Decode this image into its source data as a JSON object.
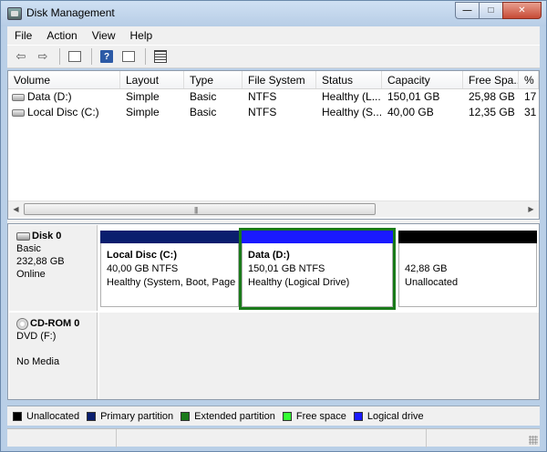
{
  "window": {
    "title": "Disk Management"
  },
  "caption": {
    "min": "—",
    "max": "□",
    "close": "✕"
  },
  "menu": [
    "File",
    "Action",
    "View",
    "Help"
  ],
  "toolbar": {
    "buttons": [
      {
        "name": "back-button",
        "glyph": "⇦"
      },
      {
        "name": "forward-button",
        "glyph": "⇨"
      },
      {
        "name": "properties-button",
        "glyph": ""
      },
      {
        "name": "help-button",
        "glyph": "?"
      },
      {
        "name": "show-hide-pane-button",
        "glyph": ""
      },
      {
        "name": "settings-button",
        "glyph": ""
      }
    ]
  },
  "volume_list": {
    "columns": [
      "Volume",
      "Layout",
      "Type",
      "File System",
      "Status",
      "Capacity",
      "Free Spa...",
      "% F"
    ],
    "rows": [
      [
        "Data (D:)",
        "Simple",
        "Basic",
        "NTFS",
        "Healthy (L...",
        "150,01 GB",
        "25,98 GB",
        "17"
      ],
      [
        "Local Disc (C:)",
        "Simple",
        "Basic",
        "NTFS",
        "Healthy (S...",
        "40,00 GB",
        "12,35 GB",
        "31"
      ]
    ],
    "scroll_grip": "|||"
  },
  "disks": {
    "disk0": {
      "name": "Disk 0",
      "type": "Basic",
      "size": "232,88 GB",
      "status": "Online",
      "partitions": [
        {
          "title": "Local Disc  (C:)",
          "size": "40,00 GB NTFS",
          "status": "Healthy (System, Boot, Page",
          "bar_color": "#0a1e6e"
        },
        {
          "title": "Data  (D:)",
          "size": "150,01 GB NTFS",
          "status": "Healthy (Logical Drive)",
          "bar_color": "#1a1aff"
        },
        {
          "title": "",
          "size": "42,88 GB",
          "status": "Unallocated",
          "bar_color": "#000000"
        }
      ]
    },
    "cdrom0": {
      "name": "CD-ROM 0",
      "type": "DVD (F:)",
      "status": "No Media"
    }
  },
  "legend": [
    {
      "label": "Unallocated",
      "color": "#000000"
    },
    {
      "label": "Primary partition",
      "color": "#0a1e6e"
    },
    {
      "label": "Extended partition",
      "color": "#1a7a1a"
    },
    {
      "label": "Free space",
      "color": "#33ff33"
    },
    {
      "label": "Logical drive",
      "color": "#1a1aff"
    }
  ]
}
